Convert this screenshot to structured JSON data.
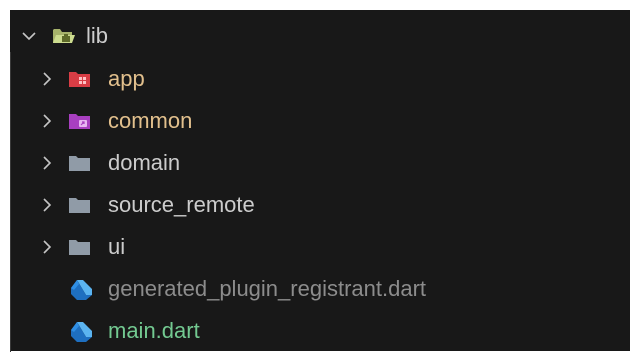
{
  "explorer": {
    "root": {
      "label": "lib",
      "icon": "folder-lib-open-icon",
      "expanded": true,
      "color": "#cccccc"
    },
    "items": [
      {
        "label": "app",
        "icon": "folder-app-icon",
        "color": "#e2c08d",
        "icon_color": "#e0454b"
      },
      {
        "label": "common",
        "icon": "folder-common-icon",
        "color": "#e2c08d",
        "icon_color": "#b046c9"
      },
      {
        "label": "domain",
        "icon": "folder-icon",
        "color": "#cccccc",
        "icon_color": "#8f9ba8"
      },
      {
        "label": "source_remote",
        "icon": "folder-icon",
        "color": "#cccccc",
        "icon_color": "#8f9ba8"
      },
      {
        "label": "ui",
        "icon": "folder-icon",
        "color": "#cccccc",
        "icon_color": "#8f9ba8"
      },
      {
        "label": "generated_plugin_registrant.dart",
        "icon": "dart-icon",
        "color": "#8c8c8c",
        "icon_color": "#2f8fe5"
      },
      {
        "label": "main.dart",
        "icon": "dart-icon",
        "color": "#73c991",
        "icon_color": "#2f8fe5"
      }
    ]
  }
}
